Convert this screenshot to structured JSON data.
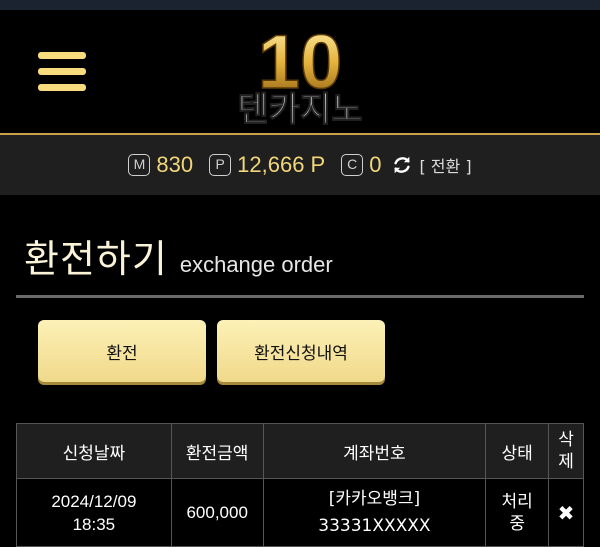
{
  "logo": {
    "number": "10",
    "name": "텐카지노"
  },
  "balance": {
    "m_badge": "M",
    "m_value": "830",
    "p_badge": "P",
    "p_value": "12,666 P",
    "c_badge": "C",
    "c_value": "0",
    "switch_label": "[ 전환 ]"
  },
  "page": {
    "title": "환전하기",
    "subtitle": "exchange order"
  },
  "buttons": {
    "exchange": "환전",
    "history": "환전신청내역"
  },
  "table": {
    "headers": [
      "신청날짜",
      "환전금액",
      "계좌번호",
      "상태",
      "삭",
      "제"
    ],
    "rows": [
      {
        "date": "2024/12/09",
        "time": "18:35",
        "amount": "600,000",
        "bank": "[카카오뱅크]",
        "account": "33331XXXXX",
        "status_1": "처리",
        "status_2": "중",
        "delete": "✖"
      }
    ]
  },
  "colors": {
    "gold": "#f2d77a",
    "link": "#6f9cff",
    "button": "#f7e3a0"
  },
  "icons": [
    "menu-icon",
    "refresh-icon",
    "delete-icon"
  ]
}
